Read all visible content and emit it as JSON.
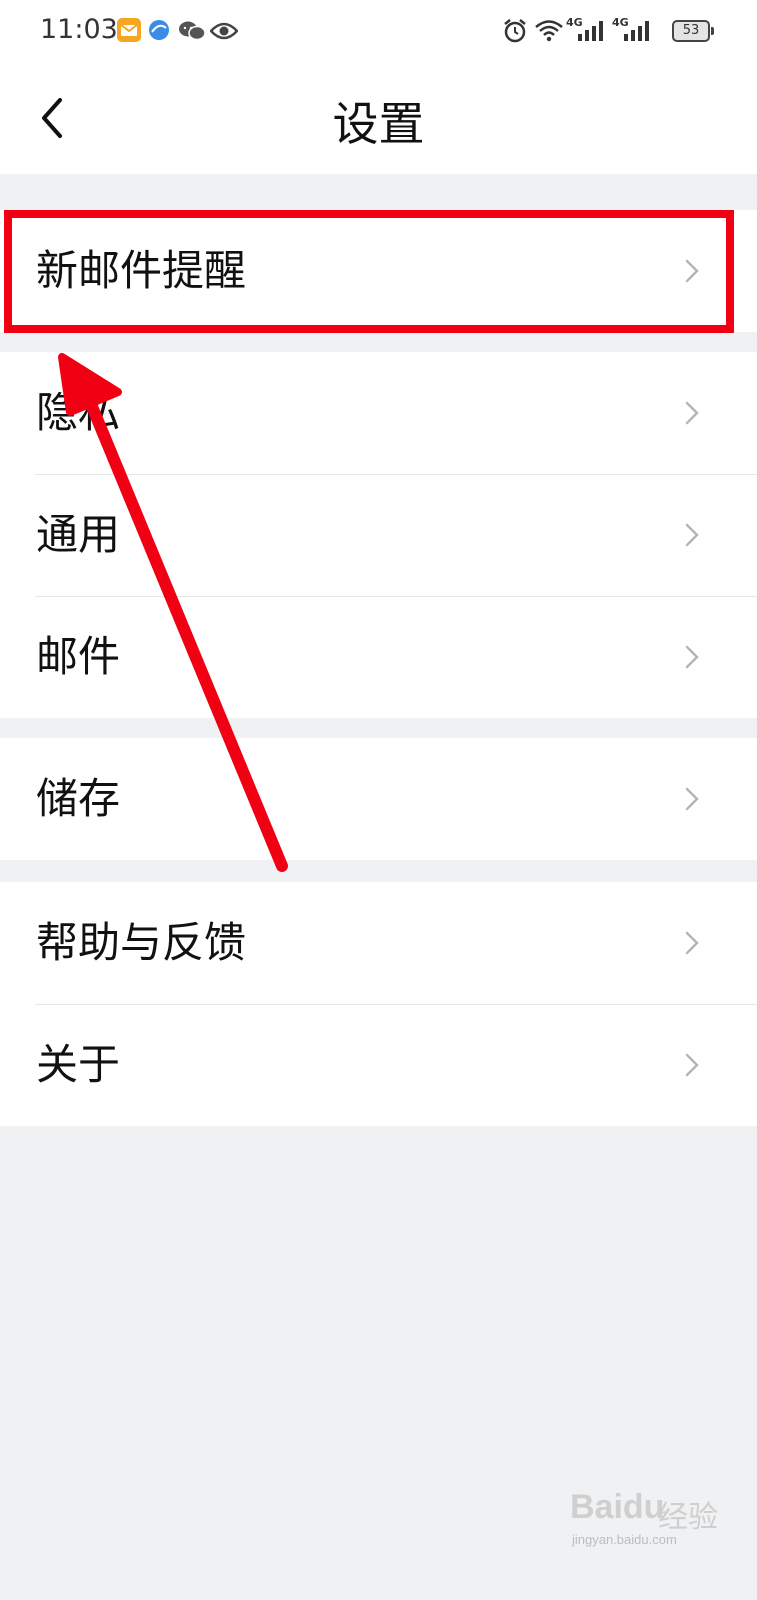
{
  "status_bar": {
    "time": "11:03",
    "battery": "53",
    "network_1": "4G",
    "network_2": "4G",
    "icons": [
      "mail-app-icon",
      "browser-icon",
      "wechat-icon",
      "eye-icon",
      "alarm-icon",
      "wifi-icon",
      "signal-icon",
      "signal-icon",
      "battery-icon"
    ]
  },
  "header": {
    "title": "设置",
    "back_icon": "chevron-left-icon"
  },
  "settings": {
    "group1": [
      {
        "label": "新邮件提醒"
      }
    ],
    "group2": [
      {
        "label": "隐私"
      },
      {
        "label": "通用"
      },
      {
        "label": "邮件"
      }
    ],
    "group3": [
      {
        "label": "储存"
      }
    ],
    "group4": [
      {
        "label": "帮助与反馈"
      },
      {
        "label": "关于"
      }
    ]
  },
  "annotation": {
    "highlight_color": "#f00012",
    "highlighted_item": "新邮件提醒"
  },
  "watermark": {
    "logo": "Baidu",
    "text": "经验",
    "url": "jingyan.baidu.com"
  }
}
